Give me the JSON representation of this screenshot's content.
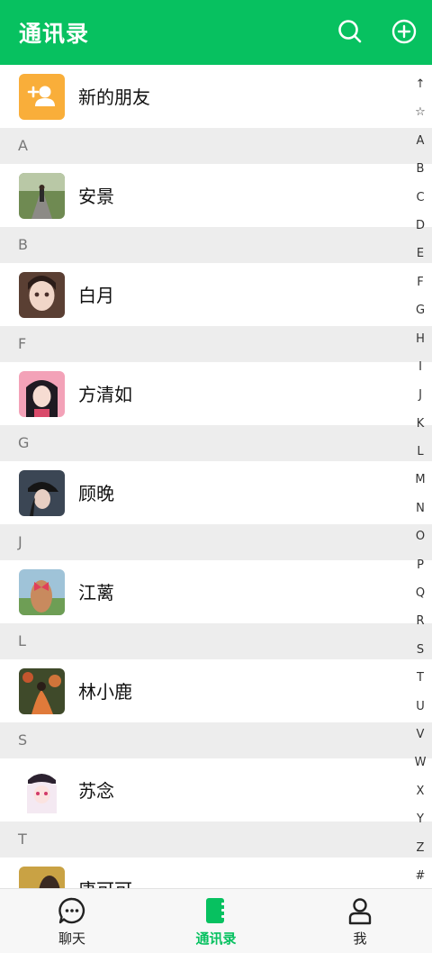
{
  "header": {
    "title": "通讯录",
    "search_icon": "search-icon",
    "add_icon": "plus-circle-icon"
  },
  "colors": {
    "brand": "#07c160",
    "section_bg": "#ededed",
    "new_friend": "#f9ae3a"
  },
  "new_friend": {
    "label": "新的朋友",
    "icon": "add-user-icon"
  },
  "groups": [
    {
      "letter": "A",
      "contacts": [
        {
          "name": "安景"
        }
      ]
    },
    {
      "letter": "B",
      "contacts": [
        {
          "name": "白月"
        }
      ]
    },
    {
      "letter": "F",
      "contacts": [
        {
          "name": "方清如"
        }
      ]
    },
    {
      "letter": "G",
      "contacts": [
        {
          "name": "顾晚"
        }
      ]
    },
    {
      "letter": "J",
      "contacts": [
        {
          "name": "江蓠"
        }
      ]
    },
    {
      "letter": "L",
      "contacts": [
        {
          "name": "林小鹿"
        }
      ]
    },
    {
      "letter": "S",
      "contacts": [
        {
          "name": "苏念"
        }
      ]
    },
    {
      "letter": "T",
      "contacts": [
        {
          "name": "唐可可"
        }
      ]
    }
  ],
  "index_bar": [
    "↑",
    "☆",
    "A",
    "B",
    "C",
    "D",
    "E",
    "F",
    "G",
    "H",
    "I",
    "J",
    "K",
    "L",
    "M",
    "N",
    "O",
    "P",
    "Q",
    "R",
    "S",
    "T",
    "U",
    "V",
    "W",
    "X",
    "Y",
    "Z",
    "#"
  ],
  "tabs": [
    {
      "label": "聊天",
      "icon": "chat-bubble-icon"
    },
    {
      "label": "通讯录",
      "icon": "contacts-book-icon",
      "active": true
    },
    {
      "label": "我",
      "icon": "person-icon"
    }
  ]
}
